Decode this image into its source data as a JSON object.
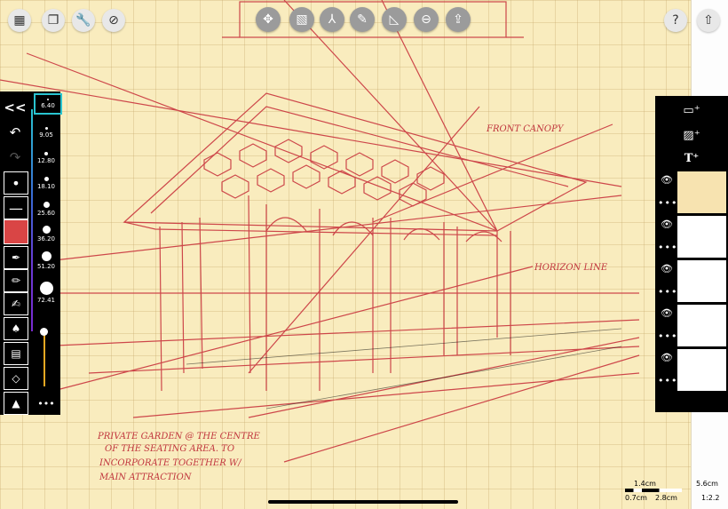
{
  "top_left_buttons": [
    {
      "name": "grid-menu-icon",
      "glyph": "▦"
    },
    {
      "name": "layers-stack-icon",
      "glyph": "❐"
    },
    {
      "name": "wrench-icon",
      "glyph": "🔧"
    },
    {
      "name": "canvas-view-icon",
      "glyph": "⊘"
    }
  ],
  "top_tools": [
    {
      "name": "transform-icon",
      "glyph": "✥"
    },
    {
      "name": "hatch-fill-icon",
      "glyph": "▧"
    },
    {
      "name": "perspective-guide-icon",
      "glyph": "⅄"
    },
    {
      "name": "pencil-icon",
      "glyph": "✎"
    },
    {
      "name": "ruler-triangle-icon",
      "glyph": "◺"
    },
    {
      "name": "minus-circle-icon",
      "glyph": "⊖"
    },
    {
      "name": "upload-icon",
      "glyph": "⇪"
    }
  ],
  "top_right_buttons": [
    {
      "name": "help-icon",
      "glyph": "?"
    },
    {
      "name": "share-icon",
      "glyph": "⇧"
    }
  ],
  "left_panel": {
    "collapse": "<<",
    "brush_sizes": [
      "6.40",
      "9.05",
      "12.80",
      "18.10",
      "25.60",
      "36.20",
      "51.20",
      "72.41"
    ],
    "current_color": "#d94545",
    "more": "•••"
  },
  "right_panel": {
    "new_layer_icons": [
      "new-page-icon",
      "add-image-icon",
      "add-text-icon"
    ],
    "text_glyph": "T",
    "layers_count": 5,
    "eye": "👁",
    "more": "•••"
  },
  "scale_bar": {
    "label_1": "1.4cm",
    "label_2": "5.6cm",
    "label_3": "0.7cm",
    "label_4": "2.8cm",
    "ratio": "1:2.2"
  },
  "handwriting": {
    "line1": "PRIVATE GARDEN @ THE CENTRE",
    "line2": "OF THE SEATING AREA. TO",
    "line3": "INCORPORATE TOGETHER W/",
    "line4": "MAIN ATTRACTION",
    "label_right1": "FRONT CANOPY",
    "label_right2": "HORIZON LINE"
  },
  "colors": {
    "accent": "#29c4d0",
    "ink": "#c0353d",
    "paper": "#f9ecbe"
  }
}
